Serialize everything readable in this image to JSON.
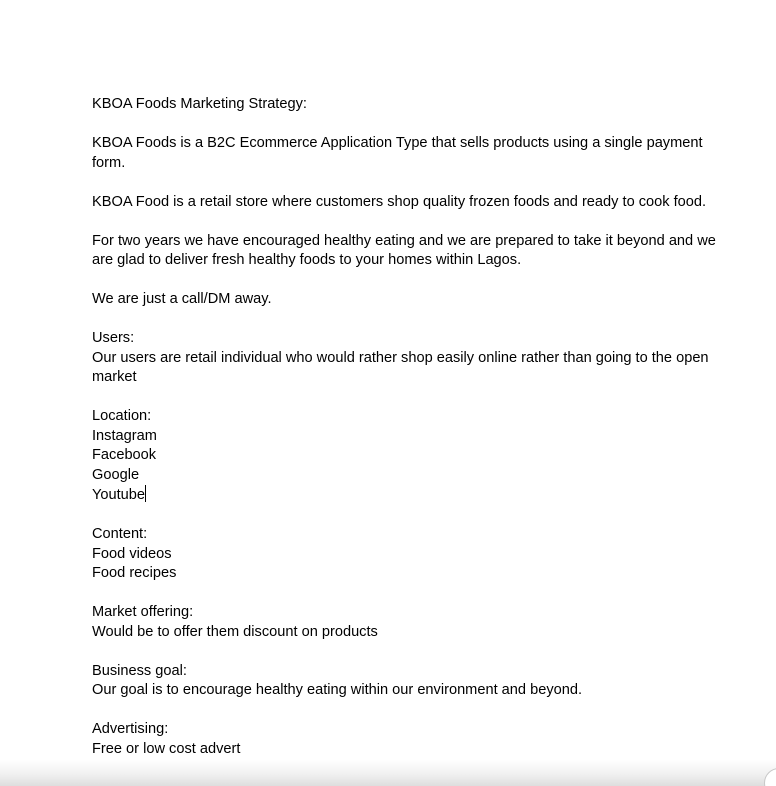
{
  "document": {
    "title": "KBOA Foods Marketing Strategy:",
    "intro_1": "KBOA Foods is a B2C Ecommerce Application Type that sells products using a single payment form.",
    "intro_2": "KBOA Food is a retail store where customers shop quality frozen foods and ready to cook food.",
    "intro_3": "For two years we have encouraged healthy eating and we are prepared to take it beyond and we are glad to deliver fresh healthy foods to your homes within Lagos.",
    "intro_4": "We are just a call/DM away.",
    "users": {
      "heading": "Users:",
      "text": "Our users are retail individual who would rather shop easily online rather than going to the open market"
    },
    "location": {
      "heading": "Location:",
      "items": [
        "Instagram",
        "Facebook",
        "Google",
        "Youtube"
      ]
    },
    "content": {
      "heading": "Content:",
      "items": [
        "Food videos",
        "Food recipes"
      ]
    },
    "market_offering": {
      "heading": "Market offering:",
      "text": "Would be to offer them discount on products"
    },
    "business_goal": {
      "heading": "Business goal:",
      "text": "Our goal is to encourage healthy eating within our environment and beyond."
    },
    "advertising": {
      "heading": "Advertising:",
      "text": "Free or low cost advert"
    }
  }
}
